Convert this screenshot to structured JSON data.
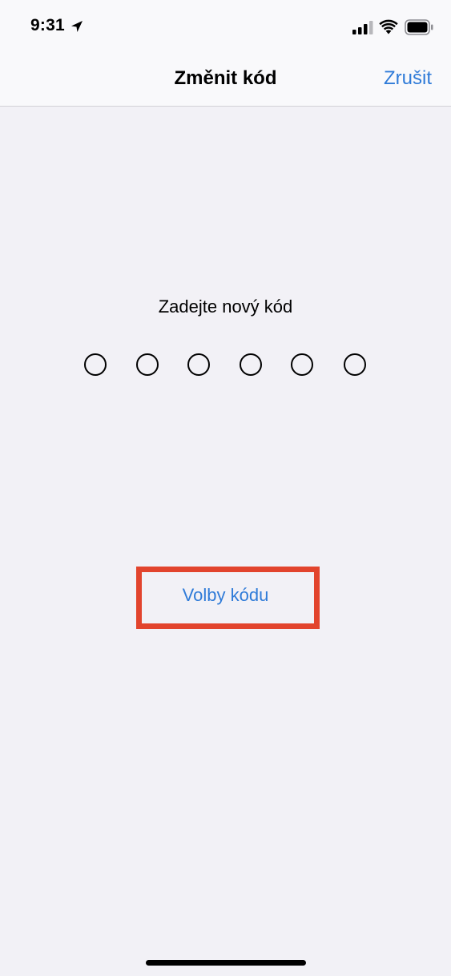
{
  "status_bar": {
    "time": "9:31",
    "icons": [
      "location-arrow-icon",
      "cellular-signal-icon",
      "wifi-icon",
      "battery-icon"
    ]
  },
  "nav": {
    "title": "Změnit kód",
    "cancel_label": "Zrušit"
  },
  "passcode": {
    "prompt": "Zadejte nový kód",
    "digit_count": 6,
    "digits_entered": 0
  },
  "options_link": {
    "label": "Volby kódu"
  },
  "colors": {
    "accent": "#2f7bd8",
    "highlight": "#e2442d",
    "background": "#f2f1f6",
    "bar_background": "#f9f9fb"
  }
}
